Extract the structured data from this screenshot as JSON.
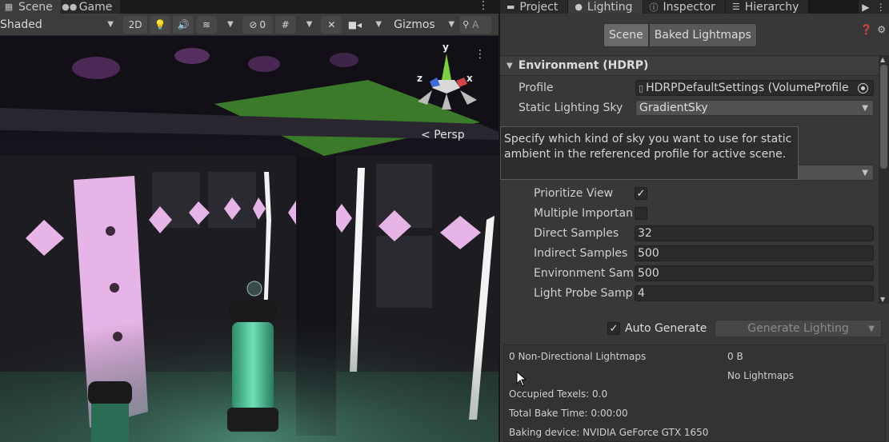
{
  "scene_pane": {
    "tabs": [
      {
        "label": "Scene",
        "icon": "scene-grid-icon",
        "active": true
      },
      {
        "label": "Game",
        "icon": "gamepad-icon",
        "active": false
      }
    ],
    "toolbar": {
      "shading_mode": "Shaded",
      "toggle_2d": "2D",
      "hidden_count": "0",
      "gizmos_label": "Gizmos",
      "search_placeholder": "A"
    },
    "viewport": {
      "projection_label": "Persp",
      "axes": {
        "x": "x",
        "y": "y",
        "z": "z"
      }
    }
  },
  "right_pane": {
    "tabs": [
      {
        "label": "Project",
        "icon": "folder-icon",
        "active": false
      },
      {
        "label": "Lighting",
        "icon": "lightbulb-icon",
        "active": true
      },
      {
        "label": "Inspector",
        "icon": "info-icon",
        "active": false
      },
      {
        "label": "Hierarchy",
        "icon": "list-icon",
        "active": false
      }
    ],
    "lighting": {
      "mode_tabs": {
        "scene": "Scene",
        "baked": "Baked Lightmaps"
      },
      "environment_header": "Environment (HDRP)",
      "profile_label": "Profile",
      "profile_value": "HDRPDefaultSettings (VolumeProfile)",
      "static_sky_label": "Static Lighting Sky",
      "static_sky_value": "GradientSky",
      "tooltip": "Specify which kind of sky you want to use for static ambient in the referenced profile for active scene.",
      "prioritize_view_label": "Prioritize View",
      "prioritize_view_checked": true,
      "multiple_importance_label": "Multiple Importance Sampling",
      "multiple_importance_checked": false,
      "direct_samples_label": "Direct Samples",
      "direct_samples_value": "32",
      "indirect_samples_label": "Indirect Samples",
      "indirect_samples_value": "500",
      "environment_samples_label": "Environment Samples",
      "environment_samples_value": "500",
      "light_probe_samples_label": "Light Probe Sample Multiplier",
      "light_probe_samples_value": "4",
      "auto_generate_label": "Auto Generate",
      "auto_generate_checked": true,
      "generate_button": "Generate Lighting"
    },
    "stats": {
      "non_directional": "0 Non-Directional Lightmaps",
      "size": "0 B",
      "no_lightmaps": "No Lightmaps",
      "occupied_texels": "Occupied Texels: 0.0",
      "total_bake_time": "Total Bake Time: 0:00:00",
      "baking_device": "Baking device: NVIDIA GeForce GTX 1650"
    }
  },
  "colors": {
    "panel_bg": "#383838",
    "field_bg": "#2a2a2a",
    "tab_active": "#3c3c3c",
    "scene_green": "#3a7a2a",
    "pink_light": "#e6b4e6",
    "glass_teal": "#4fc79a",
    "gizmo_y": "#7bd13b",
    "gizmo_x": "#d64545",
    "gizmo_z": "#3b6ed6"
  }
}
